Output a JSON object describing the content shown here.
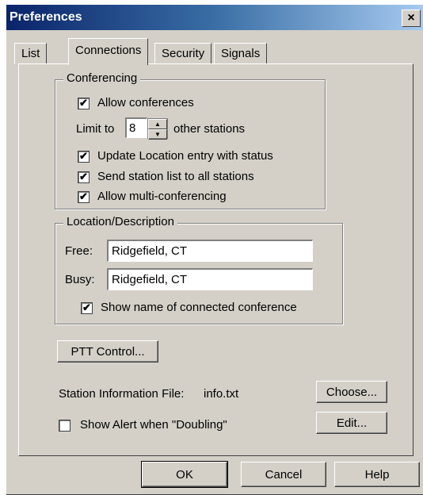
{
  "window": {
    "title": "Preferences",
    "close_label": "×"
  },
  "tabs": [
    {
      "label": "List"
    },
    {
      "label": "Connections"
    },
    {
      "label": "Security"
    },
    {
      "label": "Signals"
    }
  ],
  "conferencing": {
    "legend": "Conferencing",
    "allow_conferences": {
      "label": "Allow conferences",
      "checked": true
    },
    "limit_prefix": "Limit to",
    "limit_value": "8",
    "limit_suffix": "other stations",
    "update_location": {
      "label": "Update Location entry with status",
      "checked": true
    },
    "send_station_list": {
      "label": "Send station list to all stations",
      "checked": true
    },
    "allow_multi": {
      "label": "Allow multi-conferencing",
      "checked": true
    }
  },
  "location": {
    "legend": "Location/Description",
    "free_label": "Free:",
    "free_value": "Ridgefield, CT",
    "busy_label": "Busy:",
    "busy_value": "Ridgefield, CT",
    "show_name": {
      "label": "Show name of connected conference",
      "checked": true
    }
  },
  "ptt_button": "PTT Control...",
  "station_info": {
    "label": "Station Information File:",
    "file": "info.txt",
    "choose_button": "Choose...",
    "edit_button": "Edit..."
  },
  "show_alert": {
    "label": "Show Alert when \"Doubling\"",
    "checked": false
  },
  "footer": {
    "ok": "OK",
    "cancel": "Cancel",
    "help": "Help"
  }
}
